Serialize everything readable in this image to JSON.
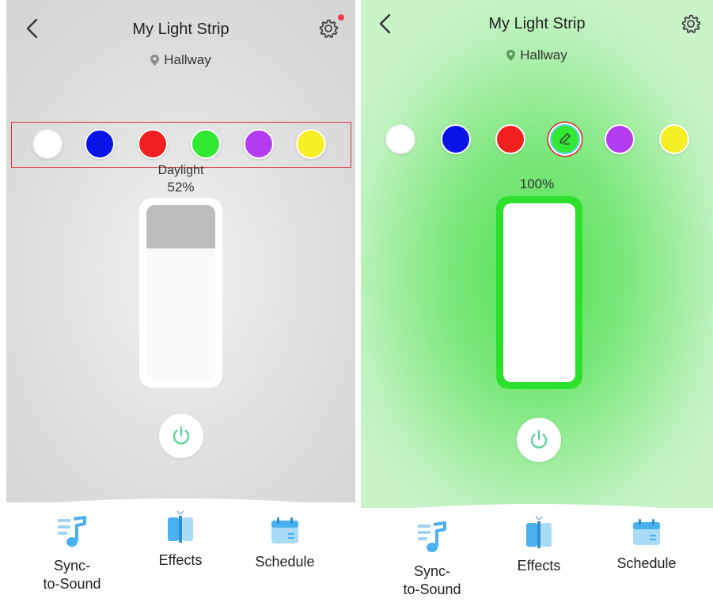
{
  "screens": [
    {
      "title": "My Light Strip",
      "location": "Hallway",
      "swatches": [
        {
          "color": "#ffffff",
          "name": "white"
        },
        {
          "color": "#0a14e6",
          "name": "blue"
        },
        {
          "color": "#f02020",
          "name": "red"
        },
        {
          "color": "#33e833",
          "name": "green"
        },
        {
          "color": "#b43cf0",
          "name": "purple"
        },
        {
          "color": "#f5f025",
          "name": "yellow"
        }
      ],
      "mode_label": "Daylight",
      "brightness_label": "52%",
      "brightness_value": 52,
      "tabs": [
        {
          "label": "Sync-\nto-Sound",
          "icon": "music-note-icon"
        },
        {
          "label": "Effects",
          "icon": "effects-icon"
        },
        {
          "label": "Schedule",
          "icon": "calendar-icon"
        }
      ]
    },
    {
      "title": "My Light Strip",
      "location": "Hallway",
      "swatches": [
        {
          "color": "#ffffff",
          "name": "white"
        },
        {
          "color": "#0a14e6",
          "name": "blue"
        },
        {
          "color": "#f02020",
          "name": "red"
        },
        {
          "color": "#33e833",
          "name": "green",
          "selected": true,
          "editable": true
        },
        {
          "color": "#b43cf0",
          "name": "purple"
        },
        {
          "color": "#f5f025",
          "name": "yellow"
        }
      ],
      "brightness_label": "100%",
      "brightness_value": 100,
      "tabs": [
        {
          "label": "Sync-\nto-Sound",
          "icon": "music-note-icon"
        },
        {
          "label": "Effects",
          "icon": "effects-icon"
        },
        {
          "label": "Schedule",
          "icon": "calendar-icon"
        }
      ]
    }
  ],
  "colors": {
    "accent": "#5fd39a",
    "icon_blue": "#4ab0f0",
    "annotation_red": "#e0313d",
    "notification": "#ff3b4a"
  }
}
